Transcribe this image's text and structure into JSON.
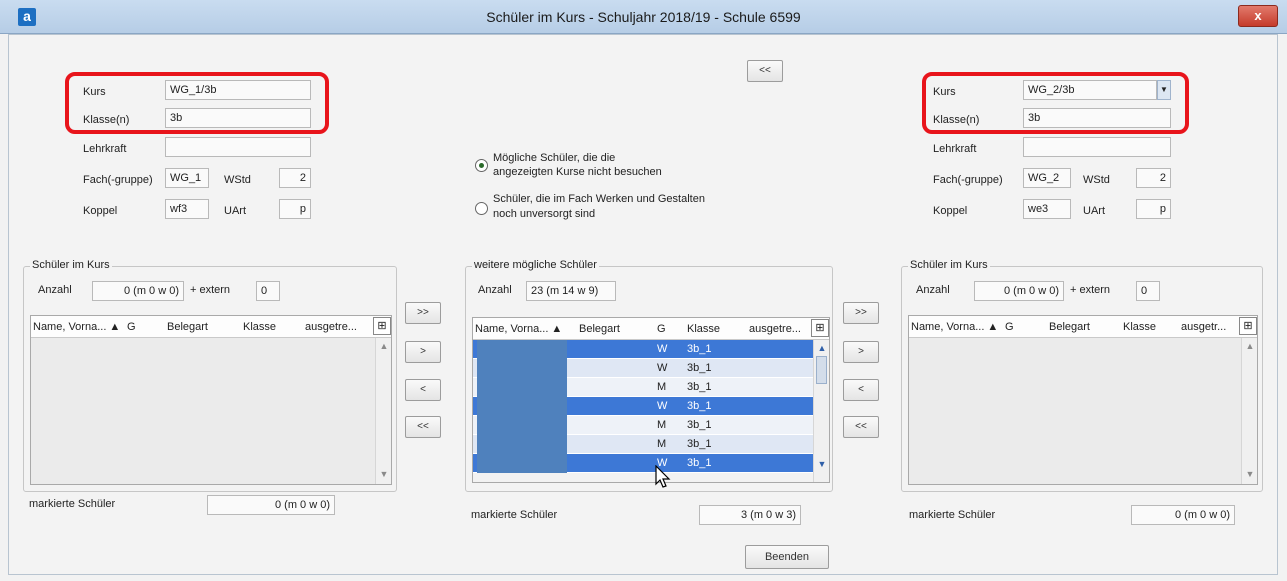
{
  "window": {
    "title": "Schüler im Kurs - Schuljahr 2018/19 - Schule 6599",
    "close": "x",
    "app_icon": "a"
  },
  "left_course": {
    "kurs_label": "Kurs",
    "kurs": "WG_1/3b",
    "klassen_label": "Klasse(n)",
    "klassen": "3b",
    "lehrkraft_label": "Lehrkraft",
    "lehrkraft": "",
    "fach_label": "Fach(-gruppe)",
    "fach": "WG_1",
    "wstd_label": "WStd",
    "wstd": "2",
    "koppel_label": "Koppel",
    "koppel": "wf3",
    "uart_label": "UArt",
    "uart": "p"
  },
  "right_course": {
    "kurs_label": "Kurs",
    "kurs": "WG_2/3b",
    "klassen_label": "Klasse(n)",
    "klassen": "3b",
    "lehrkraft_label": "Lehrkraft",
    "lehrkraft": "",
    "fach_label": "Fach(-gruppe)",
    "fach": "WG_2",
    "wstd_label": "WStd",
    "wstd": "2",
    "koppel_label": "Koppel",
    "koppel": "we3",
    "uart_label": "UArt",
    "uart": "p"
  },
  "center": {
    "back_button": "<<",
    "option1_line1": "Mögliche Schüler, die die",
    "option1_line2": "angezeigten Kurse nicht besuchen",
    "option2_line1": "Schüler, die im Fach Werken und Gestalten",
    "option2_line2": "noch unversorgt sind",
    "selected_option": 1
  },
  "left_list": {
    "group_title": "Schüler im Kurs",
    "anzahl_label": "Anzahl",
    "anzahl": "0 (m 0 w 0)",
    "extern_label": "+ extern",
    "extern": "0",
    "columns": [
      "Name, Vorna... ▲",
      "G",
      "Belegart",
      "Klasse",
      "ausgetre..."
    ],
    "marked_label": "markierte Schüler",
    "marked": "0 (m 0 w 0)"
  },
  "middle_list": {
    "group_title": "weitere mögliche Schüler",
    "anzahl_label": "Anzahl",
    "anzahl": "23 (m 14 w 9)",
    "columns": [
      "Name, Vorna... ▲",
      "Belegart",
      "G",
      "Klasse",
      "ausgetre..."
    ],
    "rows": [
      {
        "g": "W",
        "klasse": "3b_1",
        "selected": true
      },
      {
        "g": "W",
        "klasse": "3b_1",
        "selected": false
      },
      {
        "g": "M",
        "klasse": "3b_1",
        "selected": false
      },
      {
        "g": "W",
        "klasse": "3b_1",
        "selected": true
      },
      {
        "g": "M",
        "klasse": "3b_1",
        "selected": false
      },
      {
        "g": "M",
        "klasse": "3b_1",
        "selected": false
      },
      {
        "g": "W",
        "klasse": "3b_1",
        "selected": true
      }
    ],
    "marked_label": "markierte Schüler",
    "marked": "3 (m 0 w 3)"
  },
  "right_list": {
    "group_title": "Schüler im Kurs",
    "anzahl_label": "Anzahl",
    "anzahl": "0 (m 0 w 0)",
    "extern_label": "+ extern",
    "extern": "0",
    "columns": [
      "Name, Vorna... ▲",
      "G",
      "Belegart",
      "Klasse",
      "ausgetr..."
    ],
    "marked_label": "markierte Schüler",
    "marked": "0 (m 0 w 0)"
  },
  "transfer_buttons": {
    "all_right": ">>",
    "one_right": ">",
    "one_left": "<",
    "all_left": "<<"
  },
  "footer": {
    "close_button": "Beenden"
  },
  "colors": {
    "highlight": "#e8141b",
    "selection": "#3d78d6",
    "redaction": "#4f81bd"
  },
  "icons": [
    "app-icon",
    "close-icon",
    "column-menu-icon",
    "scroll-up-icon",
    "scroll-down-icon",
    "dropdown-arrow-icon",
    "mouse-cursor-icon"
  ]
}
